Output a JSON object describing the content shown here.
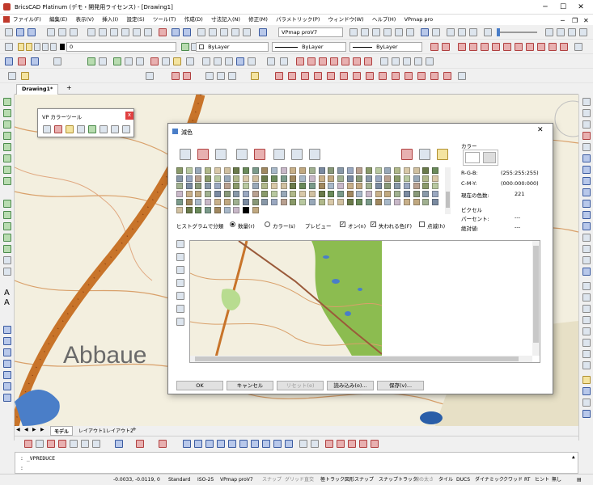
{
  "app": {
    "title": "BricsCAD Platinum (デモ・開発用ライセンス) - [Drawing1]",
    "window_controls": [
      "─",
      "☐",
      "✕"
    ]
  },
  "menu": [
    "ファイル(F)",
    "編集(E)",
    "表示(V)",
    "挿入(I)",
    "設定(S)",
    "ツール(T)",
    "作成(D)",
    "寸法記入(N)",
    "修正(M)",
    "パラメトリック(P)",
    "ウィンドウ(W)",
    "ヘルプ(H)",
    "VPmap pro"
  ],
  "toolbar": {
    "vpmap_dropdown": "VPmap proV7",
    "layer_dropdown": "0",
    "color_dropdown": "ByLayer",
    "linetype_dropdown": "ByLayer",
    "lineweight_dropdown": "ByLayer"
  },
  "doc_tabs": {
    "active": "Drawing1*",
    "add": "+"
  },
  "layout_tabs": [
    "モデル",
    "レイアウト1",
    "レイアウト2",
    "+"
  ],
  "map_label": "Abbaue",
  "vp_tool": {
    "title": "VP カラーツール",
    "close": "x"
  },
  "dialog": {
    "title": "減色",
    "close": "✕",
    "color_section": "カラー",
    "rgb_label": "R-G-B:",
    "rgb_value": "(255:255:255)",
    "cmy_label": "C-M-Y:",
    "cmy_value": "(000:000:000)",
    "current_color_label": "現在の色数:",
    "current_color_value": "221",
    "pixel_section": "ピクセル",
    "percent_label": "パーセント:",
    "percent_value": "---",
    "absolute_label": "絶対値:",
    "absolute_value": "---",
    "histogram_label": "ヒストグラムで分類",
    "sort_count": "数量(r)",
    "sort_color": "カラー(s)",
    "preview_label": "プレビュー",
    "on_label": "オン(n)",
    "lost_colors_label": "失われる色(F)",
    "blink_label": "点滅(h)",
    "buttons": {
      "ok": "OK",
      "cancel": "キャンセル",
      "reset": "リセット(e)",
      "load": "読み込み(o)...",
      "save": "保存(v)..."
    }
  },
  "command_line": {
    "history": ":  _VPREDUCE",
    "prompt": ":"
  },
  "status_bar": [
    "-0.0033, -0.0119, 0",
    "Standard",
    "ISO-25",
    "VPmap proV7",
    "スナップ",
    "グリッド",
    "直交",
    "極トラック",
    "図形スナップ",
    "スナップトラック",
    "線の太さ",
    "タイル",
    "DUCS",
    "ダイナミック",
    "クワッド",
    "RT",
    "ヒント",
    "無し"
  ],
  "colors": {
    "accent": "#cc3333",
    "map_background": "#f3efdf",
    "map_road": "#c8742a",
    "forest": "#8cbc50",
    "water": "#4a7ec8"
  }
}
